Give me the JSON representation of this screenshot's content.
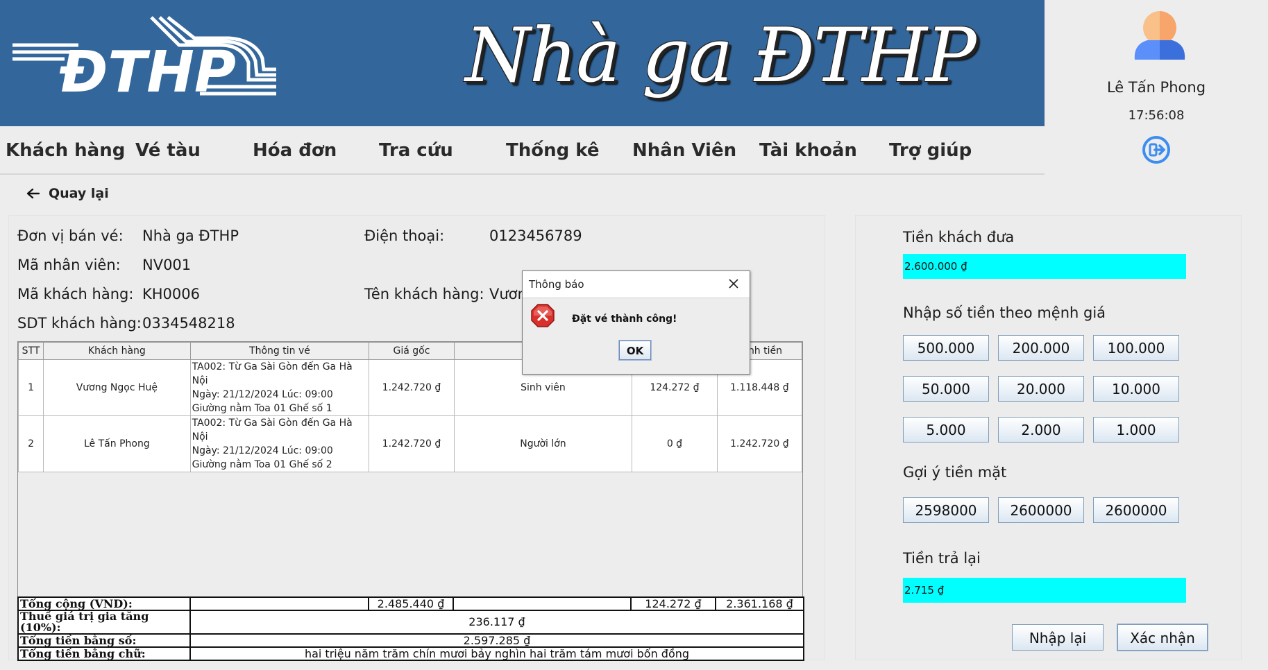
{
  "header": {
    "logo_text": "ĐTHP",
    "title": "Nhà ga ĐTHP",
    "user_name": "Lê Tấn Phong",
    "clock": "17:56:08"
  },
  "menu": [
    "Khách hàng",
    "Vé tàu",
    "Hóa đơn",
    "Tra cứu",
    "Thống kê",
    "Nhân Viên",
    "Tài khoản",
    "Trợ giúp"
  ],
  "back_label": "Quay lại",
  "invoice": {
    "seller_label": "Đơn vị bán vé:",
    "seller_value": "Nhà ga ĐTHP",
    "phone_label": "Điện thoại:",
    "phone_value": "0123456789",
    "employee_label": "Mã nhân viên:",
    "employee_value": "NV001",
    "customer_id_label": "Mã khách hàng:",
    "customer_id_value": "KH0006",
    "customer_name_label": "Tên khách hàng:",
    "customer_name_value": "Vươn",
    "customer_phone_label": "SDT khách hàng:",
    "customer_phone_value": "0334548218"
  },
  "table": {
    "headers": [
      "STT",
      "Khách hàng",
      "Thông tin vé",
      "Giá gốc",
      "",
      "",
      "ành tiền"
    ],
    "rows": [
      {
        "stt": "1",
        "customer": "Vương Ngọc Huệ",
        "info": [
          "TA002: Từ Ga Sài Gòn đến Ga Hà Nội",
          "Ngày: 21/12/2024   Lúc: 09:00",
          "Giường nằm Toa 01 Ghế số 1"
        ],
        "price": "1.242.720 ₫",
        "type": "Sinh viên",
        "discount": "124.272 ₫",
        "total": "1.118.448 ₫"
      },
      {
        "stt": "2",
        "customer": "Lê Tấn Phong",
        "info": [
          "TA002: Từ Ga Sài Gòn đến Ga Hà Nội",
          "Ngày: 21/12/2024   Lúc: 09:00",
          "Giường nằm Toa 01 Ghế số 2"
        ],
        "price": "1.242.720 ₫",
        "type": "Người lớn",
        "discount": "0 ₫",
        "total": "1.242.720 ₫"
      }
    ]
  },
  "totals": {
    "sum_label": "Tổng cộng (VND):",
    "sum_price": "2.485.440 ₫",
    "sum_discount": "124.272 ₫",
    "sum_total": "2.361.168 ₫",
    "vat_label": "Thuế giá trị gia tăng (10%):",
    "vat_value": "236.117 ₫",
    "number_label": "Tổng tiền bằng số:",
    "number_value": "2.597.285 ₫",
    "words_label": "Tổng tiền bằng chữ:",
    "words_value": "hai triệu năm trăm chín mươi bảy nghìn hai trăm tám mươi bốn đồng"
  },
  "payment": {
    "given_label": "Tiền khách đưa",
    "given_value": "2.600.000 ₫",
    "denom_label": "Nhập số tiền theo mệnh giá",
    "denominations": [
      "500.000",
      "200.000",
      "100.000",
      "50.000",
      "20.000",
      "10.000",
      "5.000",
      "2.000",
      "1.000"
    ],
    "suggest_label": "Gợi ý tiền mặt",
    "suggestions": [
      "2598000",
      "2600000",
      "2600000"
    ],
    "change_label": "Tiền trả lại",
    "change_value": "2.715 ₫",
    "reset_label": "Nhập lại",
    "confirm_label": "Xác nhận"
  },
  "dialog": {
    "title": "Thông báo",
    "message": "Đặt vé thành công!",
    "ok_label": "OK"
  },
  "colors": {
    "banner": "#33669a",
    "cyan_field": "#00ffff",
    "error_icon": "#d9302c"
  }
}
